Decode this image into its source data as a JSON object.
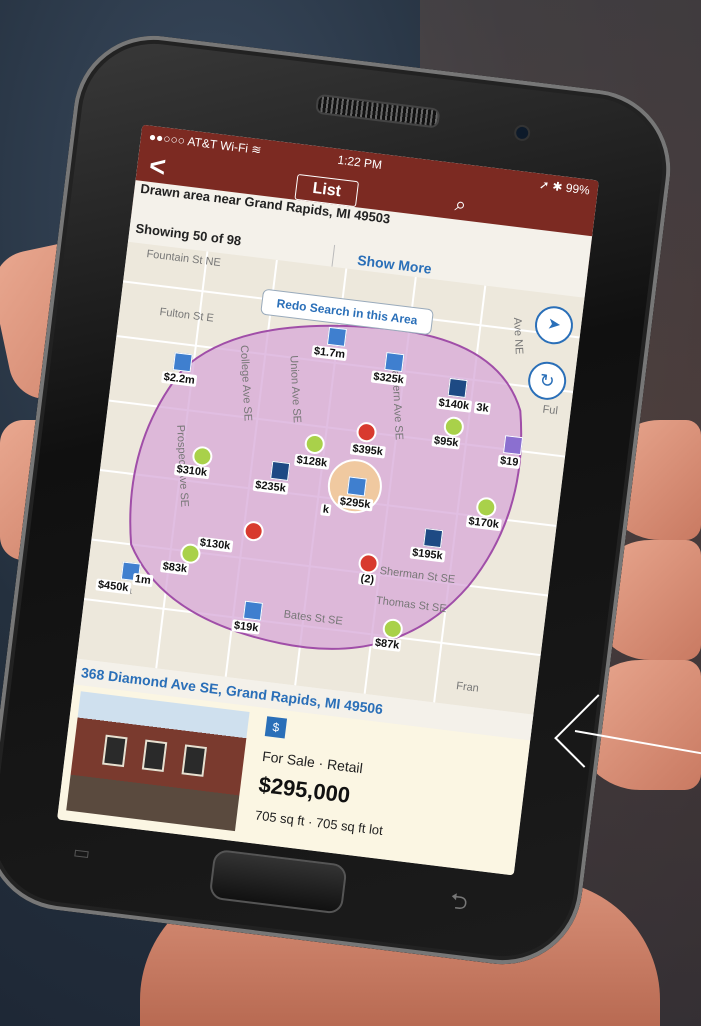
{
  "status": {
    "carrier": "●●○○○ AT&T Wi-Fi ≋",
    "time": "1:22 PM",
    "battery": "➚ ✱ 99%"
  },
  "topbar": {
    "back": "<",
    "list_label": "List",
    "search_icon": "search-icon",
    "home_icon": "home-icon"
  },
  "subhead": {
    "area": "Drawn area near Grand Rapids, MI 49503",
    "showing": "Showing 50 of 98",
    "show_more": "Show More"
  },
  "map": {
    "redo_label": "Redo Search in this Area",
    "streets": [
      "Fountain St NE",
      "Fulton St E",
      "College Ave SE",
      "Union Ave SE",
      "Eastern Ave SE",
      "Ave NE",
      "Prospect Ave SE",
      "Bates St SE",
      "Thomas St SE",
      "Sherman St SE",
      "Fran",
      "Fra",
      "Ful"
    ],
    "labels": [
      "$1.7m",
      "$325k",
      "$140k",
      "$2.2m",
      "$95k",
      "$19",
      "$395k",
      "$128k",
      "$310k",
      "$235k",
      "$295k",
      "$170k",
      "$195k",
      "$130k",
      "$83k",
      "$450k",
      "$19k",
      "$87k",
      "(2)",
      "3k",
      "k",
      "1m"
    ]
  },
  "listing": {
    "address": "368 Diamond Ave SE, Grand Rapids, MI 49506",
    "sale_type": "For Sale · Retail",
    "price": "$295,000",
    "size": "705 sq ft · 705 sq ft lot"
  },
  "colors": {
    "brand": "#7c2a22",
    "link": "#2a6fb8",
    "polygon": "#d7a8d8",
    "marker_blue": "#3f7fcf",
    "marker_green": "#a9d14a",
    "marker_red": "#d83a2e"
  }
}
